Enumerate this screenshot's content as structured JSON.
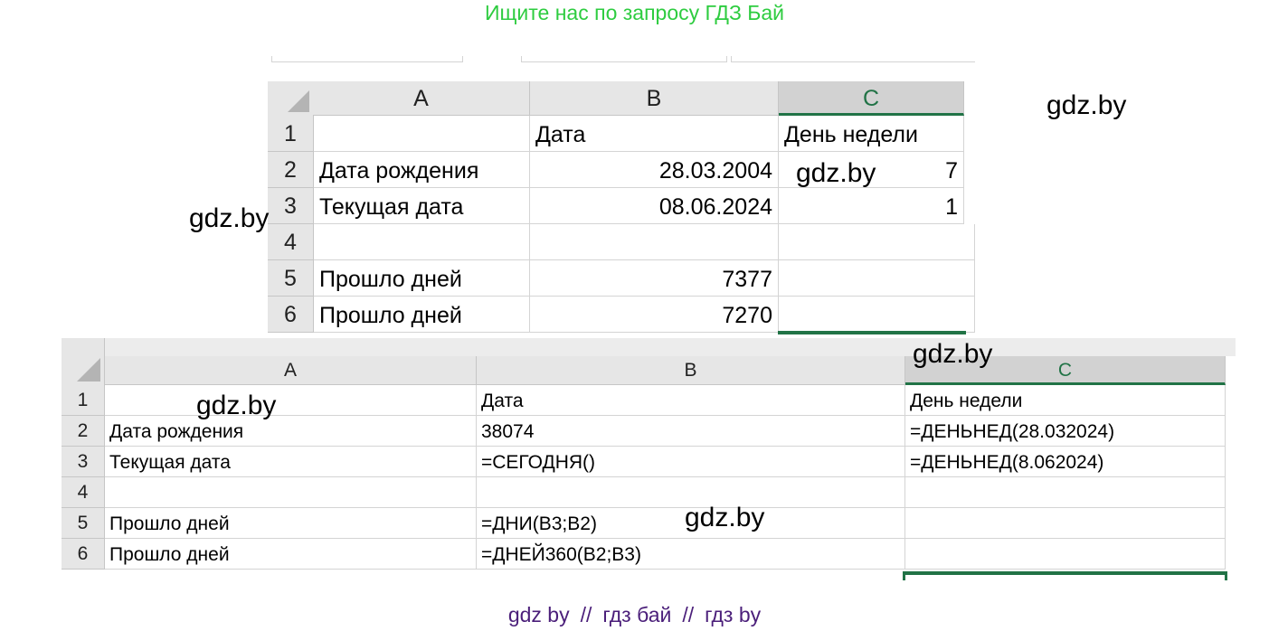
{
  "banner_top": "Ищите нас по запросу ГДЗ Бай",
  "banner_bottom": [
    "gdz by",
    "гдз бай",
    "гдз by"
  ],
  "banner_separator": "//",
  "watermark": "gdz.by",
  "sheet1": {
    "columns": [
      "A",
      "B",
      "C"
    ],
    "rows": [
      "1",
      "2",
      "3",
      "4",
      "5",
      "6"
    ],
    "cells": {
      "b1": "Дата",
      "c1": "День недели",
      "a2": "Дата рождения",
      "b2": "28.03.2004",
      "c2": "7",
      "a3": "Текущая дата",
      "b3": "08.06.2024",
      "c3": "1",
      "a5": "Прошло дней",
      "b5": "7377",
      "a6": "Прошло дней",
      "b6": "7270"
    }
  },
  "sheet2": {
    "columns": [
      "A",
      "B",
      "C"
    ],
    "rows": [
      "1",
      "2",
      "3",
      "4",
      "5",
      "6"
    ],
    "cells": {
      "b1": "Дата",
      "c1": "День недели",
      "a2": "Дата рождения",
      "b2": "38074",
      "c2": "=ДЕНЬНЕД(28.032024)",
      "a3": "Текущая дата",
      "b3": "=СЕГОДНЯ()",
      "c3": "=ДЕНЬНЕД(8.062024)",
      "a5": "Прошло дней",
      "b5": "=ДНИ(B3;B2)",
      "a6": "Прошло дней",
      "b6": "=ДНЕЙ360(B2;B3)"
    }
  },
  "colors": {
    "banner_top": "#2ecc40",
    "banner_bottom": "#4b1f7a",
    "selection": "#217346",
    "header_bg": "#e6e6e6"
  }
}
